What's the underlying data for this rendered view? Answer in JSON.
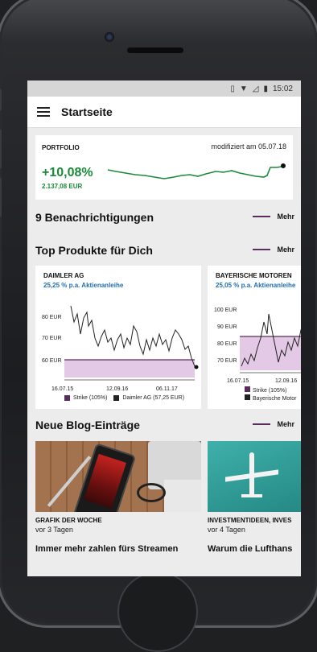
{
  "status_bar": {
    "time": "15:02"
  },
  "app_bar": {
    "title": "Startseite"
  },
  "portfolio": {
    "label": "PORTFOLIO",
    "modified": "modifiziert am 05.07.18",
    "change_pct": "+10,08%",
    "change_eur": "2.137,08 EUR"
  },
  "notifications": {
    "title": "9 Benachrichtigungen",
    "more": "Mehr"
  },
  "products": {
    "title": "Top Produkte für Dich",
    "more": "Mehr",
    "cards": [
      {
        "name": "DAIMLER AG",
        "subtitle": "25,25 % p.a. Aktienanleihe",
        "y_ticks": [
          "80 EUR",
          "70 EUR",
          "60 EUR"
        ],
        "x_ticks": [
          "16.07.15",
          "12.09.16",
          "06.11.17"
        ],
        "legend_strike": "Strike (105%)",
        "legend_underlying": "Daimler AG (57,25 EUR)"
      },
      {
        "name": "BAYERISCHE MOTOREN",
        "subtitle": "25,05 % p.a. Aktienanleihe",
        "y_ticks": [
          "100 EUR",
          "90 EUR",
          "80 EUR",
          "70 EUR"
        ],
        "x_ticks": [
          "16.07.15",
          "12.09.16"
        ],
        "legend_strike": "Strike (105%)",
        "legend_underlying": "Bayerische Motor"
      }
    ]
  },
  "blog": {
    "title": "Neue Blog-Einträge",
    "more": "Mehr",
    "cards": [
      {
        "category": "GRAFIK DER WOCHE",
        "date": "vor 3 Tagen",
        "title": "Immer mehr zahlen fürs Streamen"
      },
      {
        "category": "INVESTMENTIDEEN, INVES",
        "date": "vor 4 Tagen",
        "title": "Warum die Lufthans"
      }
    ]
  },
  "colors": {
    "accent": "#5a2d5e",
    "positive": "#1a8a3a",
    "link": "#1e6fb0",
    "strike_fill": "#e3c9e6"
  }
}
